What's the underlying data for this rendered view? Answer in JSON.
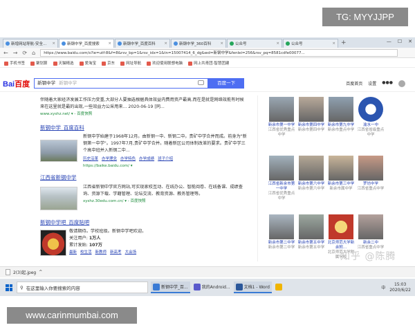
{
  "watermark_top": "TG: MYYJJPP",
  "watermark_bottom": "www.carinmumbai.com",
  "zhihu_mark": "知乎 @陈腾",
  "tabs": [
    {
      "label": "新增网站导航-安全...",
      "active": false
    },
    {
      "label": "新钢中学_百度搜索",
      "active": true
    },
    {
      "label": "新钢中学_百度百科",
      "active": false
    },
    {
      "label": "新钢中学_360百科",
      "active": false
    },
    {
      "label": "公众号",
      "active": false
    },
    {
      "label": "公众号",
      "active": false
    }
  ],
  "new_tab": "+",
  "window_controls": [
    "—",
    "☐",
    "✕"
  ],
  "address": {
    "url": "https://www.baidu.com/s?ie=utf-8&f=8&rsv_bp=1&rsv_idx=1&tn=15007414_6_dg&wd=新钢中学&fenlei=256&rsv_pq=8581cdfe00077..."
  },
  "nav": [
    "←",
    "→",
    "⟳",
    "⌂"
  ],
  "bookmarks": [
    "手机书签",
    "聚划算",
    "天猫精选",
    "爱淘宝",
    "京东",
    "网址导航",
    "欢迎使用联想电脑",
    "网上共青团·智慧团建"
  ],
  "search": {
    "logo_main": "Bai",
    "logo_accent": "百度",
    "query": "新钢中学",
    "placeholder": "新钢中学",
    "button": "百度一下",
    "links": [
      "百度首页",
      "设置",
      "●●●"
    ]
  },
  "results": {
    "snippet_top": "伴随着大家经济发展工作压力变重,大部分人要抽选根据具体效益内费用资产最高,而在是就是网络效能有时候来在这里就是最的出现,一些效益力公采用来... 2020-06-19 [同...",
    "snippet_top_url": "www.xyshz.net/ ▾ - 百度快照",
    "baike_title": "新钢中学_百度百科",
    "baike_text": "新钢中学始建于1968年12月。由新钢一中、新钢二中。贵矿中学合并而成。前身为\"新钢第一中学\"。1997年7月,贵矿中学合并。随着新区公司体制改革的要求。贵矿中学三个高中班并入新钢二中...",
    "baike_links": [
      "历史沿革",
      "办学理念",
      "办学特色",
      "办学成绩",
      "班子介绍"
    ],
    "baike_url": "https://baike.baidu.com/ ▾",
    "jx_title": "江西省新钢中学",
    "jx_text": "江西省新钢中学官方网站,可实现家校互动、在线办公、智能阅卷、在线备课、成绩查询、资源下载、学籍管理、论坛交流、教育资源、教务管理等。",
    "jx_url": "xyshz.30edu.com.cn/ ▾ - 百度快照",
    "tieba_title": "新钢中学吧_百度贴吧",
    "tieba_intro": "敬请期待。学校班级。新钢中学吧欢迎。",
    "tieba_users_label": "关注用户:",
    "tieba_users": "1万人",
    "tieba_posts_label": "累计发贴:",
    "tieba_posts": "107万",
    "tieba_links": [
      "最新",
      "校生活",
      "新教师",
      "新高考",
      "大会场"
    ]
  },
  "right_cells": [
    {
      "name": "新余市第一中学",
      "sub": "江西省优秀重点中学"
    },
    {
      "name": "新余市第四中学",
      "sub": "新余市第四中学"
    },
    {
      "name": "新余市第九中学",
      "sub": "新余市重点中学"
    },
    {
      "name": "渝水一中",
      "sub": "江西省省级重点中学"
    },
    {
      "name": "江西省新余市第一中学",
      "sub": "江西省优秀重点中学"
    },
    {
      "name": "新余市第六中学",
      "sub": "新余市第六中学"
    },
    {
      "name": "新余市第三中学",
      "sub": "新余市属中学"
    },
    {
      "name": "罗坊中学",
      "sub": "江西省重点中学"
    },
    {
      "name": "新余市第二中学",
      "sub": "新余市第二中学"
    },
    {
      "name": "新余市第五中学",
      "sub": "新余市第五中学"
    },
    {
      "name": "北京师范大学新余附...",
      "sub": "北京师范大学附属学校"
    },
    {
      "name": "新余二中",
      "sub": "江西省重点中学"
    }
  ],
  "download": {
    "file": "2(3)起.jpeg",
    "toggle": "^"
  },
  "taskbar": {
    "search_placeholder": "在这里输入你要搜索的内容",
    "apps": [
      {
        "label": "新钢中学_百...",
        "on": true,
        "color": "#3a7bd5"
      },
      {
        "label": "我的Android...",
        "on": false,
        "color": "#5a5acb"
      },
      {
        "label": "文档1 - Word",
        "on": true,
        "color": "#2b579a"
      },
      {
        "label": "",
        "on": false,
        "color": "#f0b400"
      }
    ],
    "time": "15:03",
    "date": "2020/6/22",
    "ime": "中"
  }
}
